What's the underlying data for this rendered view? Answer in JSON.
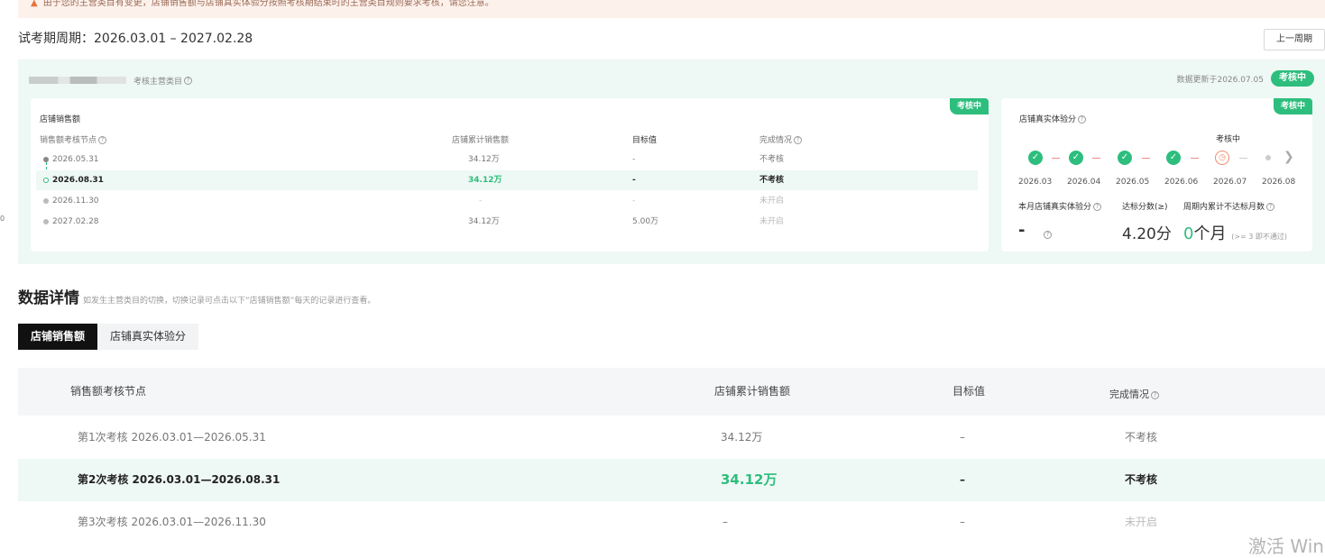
{
  "notice": {
    "icon": "warning-icon",
    "text": "由于您的主营类目有变更，店铺销售额与店铺真实体验分按照考核期结束时的主营类目规则要求考核，请您注意。"
  },
  "period": {
    "label": "试考期周期：2026.03.01 – 2027.02.28",
    "prev_button": "上一周期"
  },
  "category": {
    "label": "考核主营类目",
    "update_text": "数据更新于2026.07.05",
    "status": "考核中"
  },
  "sales_card": {
    "tag": "考核中",
    "title": "店铺销售额",
    "headers": [
      "销售额考核节点",
      "店铺累计销售额",
      "目标值",
      "完成情况"
    ],
    "rows": [
      {
        "node": "2026.05.31",
        "amount": "34.12万",
        "target": "-",
        "status": "不考核"
      },
      {
        "node": "2026.08.31",
        "amount": "34.12万",
        "target": "-",
        "status": "不考核"
      },
      {
        "node": "2026.11.30",
        "amount": "-",
        "target": "-",
        "status": "未开启"
      },
      {
        "node": "2027.02.28",
        "amount": "34.12万",
        "target": "5.00万",
        "status": "未开启"
      }
    ]
  },
  "experience_card": {
    "tag": "考核中",
    "title": "店铺真实体验分",
    "current_status": "考核中",
    "months": [
      "2026.03",
      "2026.04",
      "2026.05",
      "2026.06",
      "2026.07",
      "2026.08"
    ],
    "metric_headers": [
      "本月店铺真实体验分",
      "达标分数(≥)",
      "周期内累计不达标月数"
    ],
    "current_score": "-",
    "standard_score": "4.20分",
    "fail_months_value": "0",
    "fail_months_unit": "个月",
    "fail_note": "(>= 3 即不通过)"
  },
  "details": {
    "title": "数据详情",
    "subtitle": "如发生主营类目的切换，切换记录可点击以下“店铺销售额”每天的记录进行查看。",
    "tabs": [
      "店铺销售额",
      "店铺真实体验分"
    ],
    "headers": [
      "销售额考核节点",
      "店铺累计销售额",
      "目标值",
      "完成情况"
    ],
    "rows": [
      {
        "node": "第1次考核 2026.03.01—2026.05.31",
        "amount": "34.12万",
        "target": "–",
        "status": "不考核"
      },
      {
        "node": "第2次考核 2026.03.01—2026.08.31",
        "amount": "34.12万",
        "target": "–",
        "status": "不考核"
      },
      {
        "node": "第3次考核 2026.03.01—2026.11.30",
        "amount": "–",
        "target": "–",
        "status": "未开启"
      }
    ]
  },
  "watermark": "激活 Win",
  "edge_mark": "0",
  "colors": {
    "accent": "#2dbe7d",
    "notice_bg": "#fdf1ec",
    "panel_bg": "#eef8f4"
  }
}
